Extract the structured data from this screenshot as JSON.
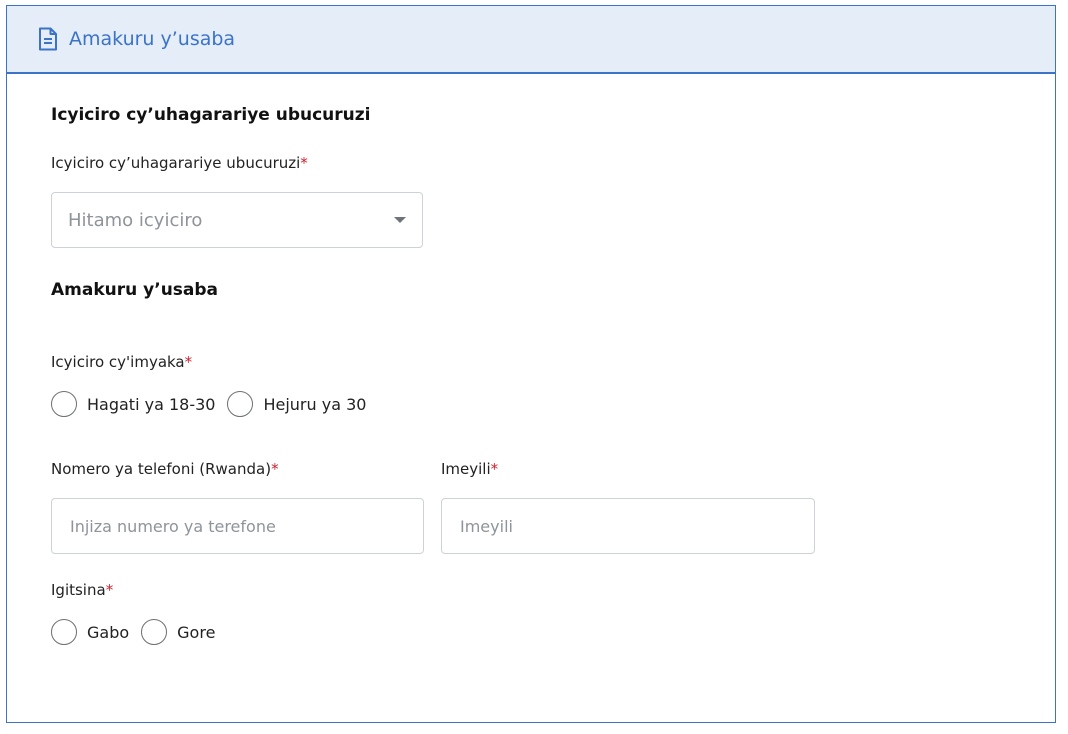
{
  "header": {
    "title": "Amakuru y’usaba",
    "icon": "document-icon",
    "accent": "#3b73c8"
  },
  "section1": {
    "title": "Icyiciro cy’uhagarariye ubucuruzi",
    "field_label": "Icyiciro cy’uhagarariye ubucuruzi",
    "select_placeholder": "Hitamo icyiciro"
  },
  "section2": {
    "title": "Amakuru y’usaba",
    "age": {
      "label": "Icyiciro cy'imyaka",
      "options": [
        "Hagati ya 18-30",
        "Hejuru ya 30"
      ]
    },
    "phone": {
      "label": "Nomero ya telefoni (Rwanda)",
      "placeholder": "Injiza numero ya terefone"
    },
    "email": {
      "label": "Imeyili",
      "placeholder": "Imeyili"
    },
    "gender": {
      "label": "Igitsina",
      "options": [
        "Gabo",
        "Gore"
      ]
    }
  },
  "required_marker": "*",
  "colors": {
    "required": "#d0202f",
    "header_bg": "#e4edf8"
  }
}
